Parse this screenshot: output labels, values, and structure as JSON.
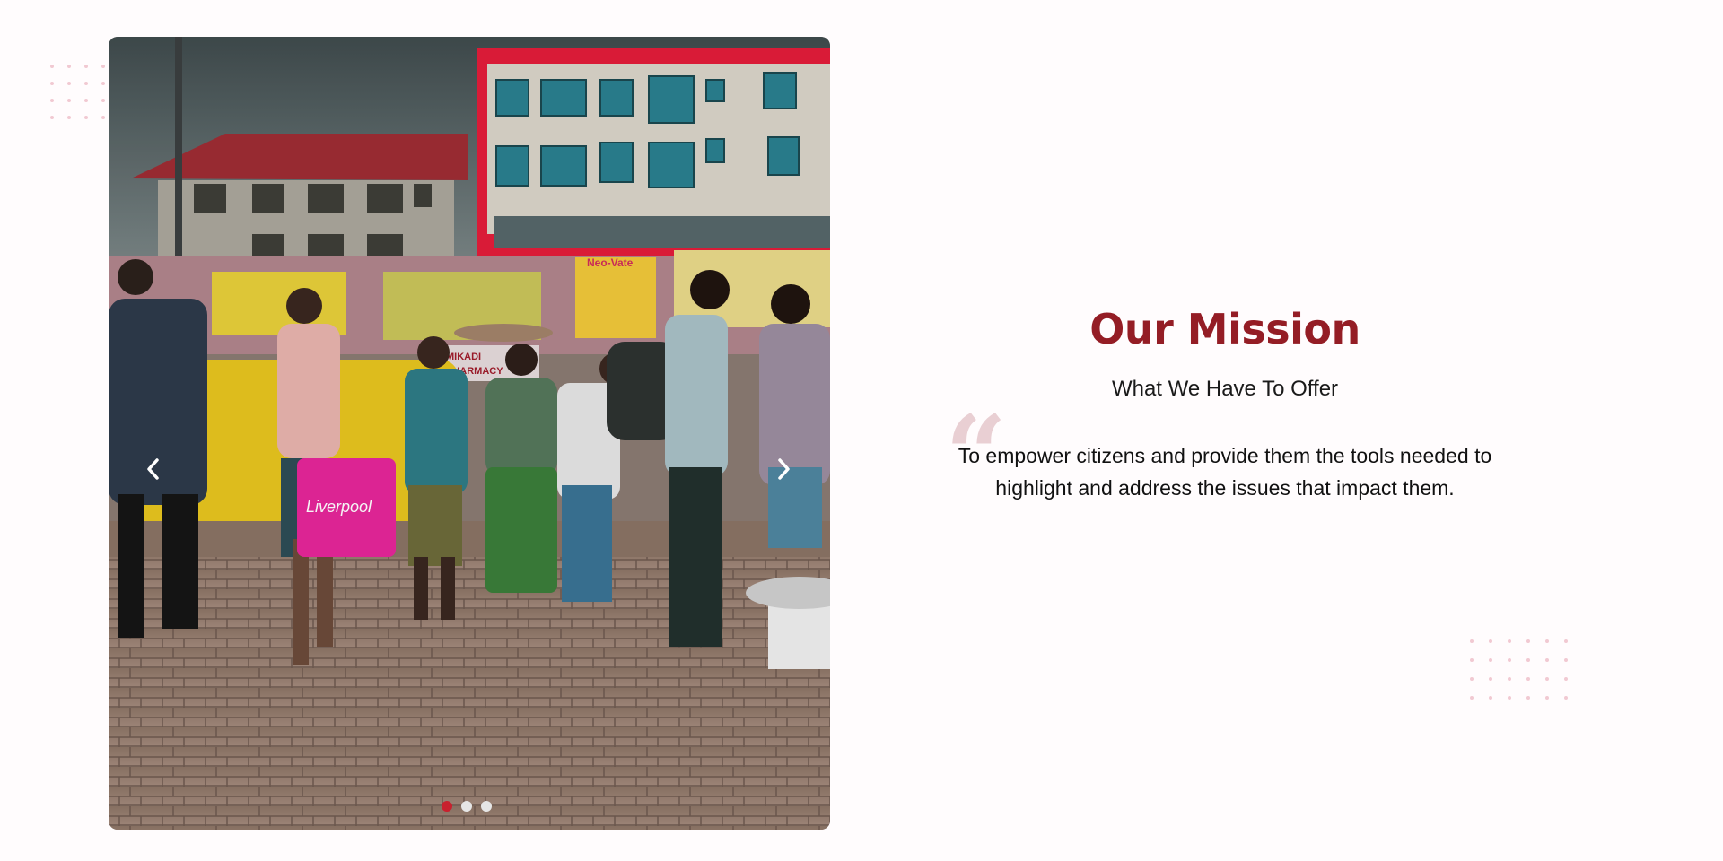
{
  "carousel": {
    "bag_text": "Liverpool",
    "sign_text": "MIKADI PHARMACY",
    "billboard_text": "Neo-Vate",
    "slides_total": 3,
    "active_slide": 1,
    "accent_color": "#c8202e"
  },
  "icons": {
    "prev": "chevron-left-icon",
    "next": "chevron-right-icon",
    "quote": "quote-icon"
  },
  "mission": {
    "title": "Our Mission",
    "subtitle": "What We Have To Offer",
    "quote_mark": "“",
    "text": "To empower citizens and provide them the tools needed to highlight and address the issues that impact them.",
    "title_color": "#941d25"
  },
  "decor": {
    "dot_color": "#f1c9d2"
  }
}
